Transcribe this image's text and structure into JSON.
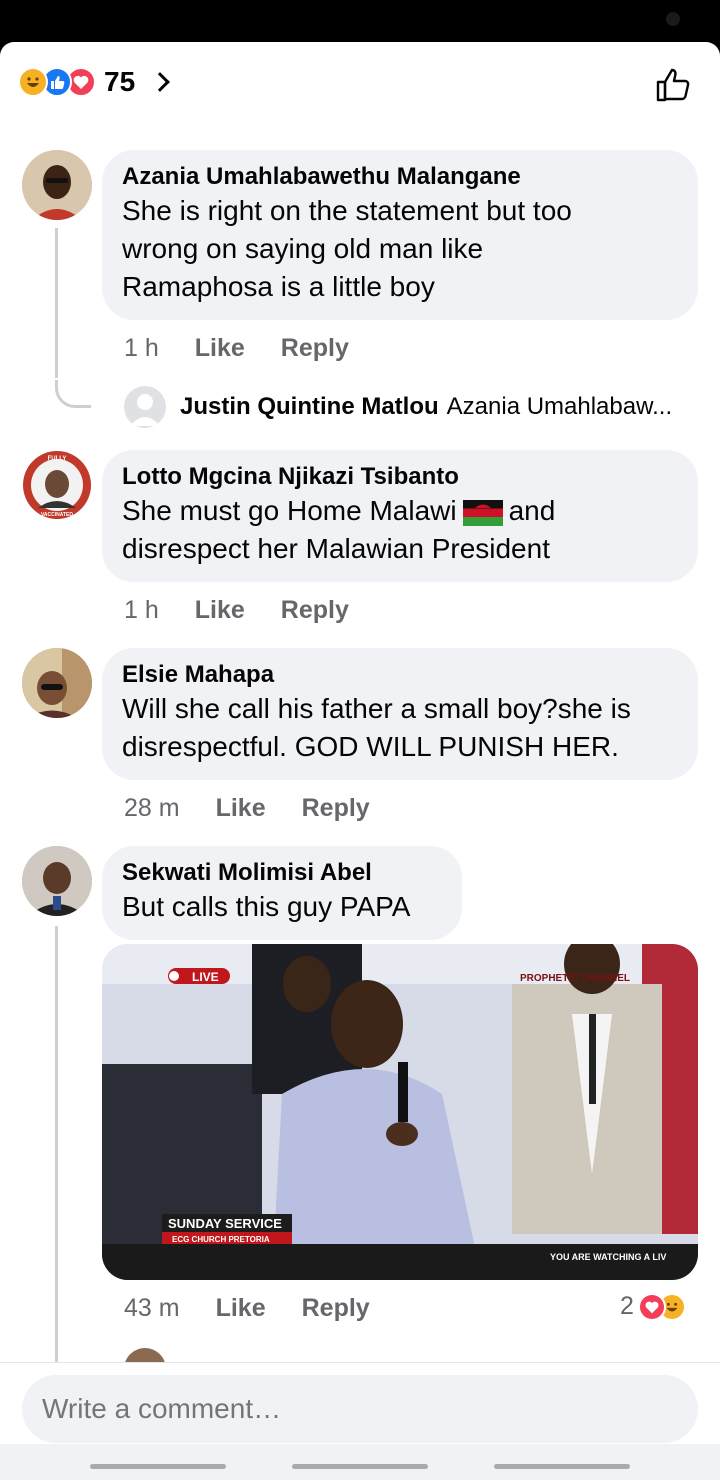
{
  "header": {
    "reaction_count": "75",
    "reaction_icons": [
      "haha-icon",
      "like-icon",
      "love-icon"
    ]
  },
  "comments": [
    {
      "author": "Azania Umahlabawethu Malangane",
      "text_lines": [
        "She is right on the statement but too",
        "wrong on saying old man like",
        "Ramaphosa is a little boy"
      ],
      "time": "1 h",
      "like": "Like",
      "reply": "Reply"
    },
    {
      "author": "Lotto Mgcina Njikazi Tsibanto",
      "text_line1_a": "She must go Home Malawi",
      "text_line1_b": "and",
      "text_line2": "disrespect her Malawian President",
      "time": "1 h",
      "like": "Like",
      "reply": "Reply"
    },
    {
      "author": "Elsie Mahapa",
      "text_lines": [
        "Will she call his father a small boy?she is",
        "disrespectful. GOD WILL PUNISH HER."
      ],
      "time": "28 m",
      "like": "Like",
      "reply": "Reply"
    },
    {
      "author": "Sekwati Molimisi Abel",
      "text_lines": [
        "But calls this guy PAPA"
      ],
      "time": "43 m",
      "like": "Like",
      "reply": "Reply",
      "reaction_count": "2"
    }
  ],
  "reply_preview": {
    "author": "Justin Quintine Matlou",
    "preview": "Azania Umahlabaw..."
  },
  "media": {
    "live_badge": "LIVE",
    "channel": "PROPHETIC CHANNEL",
    "lower_third_title": "SUNDAY SERVICE",
    "lower_third_sub": "ECG CHURCH PRETORIA",
    "ticker": "YOU ARE WATCHING A LIV"
  },
  "avatar_badge_top": "FULLY",
  "avatar_badge_bottom": "VACCINATED",
  "composer": {
    "placeholder": "Write a comment…"
  },
  "colors": {
    "bubble": "#f0f2f5",
    "meta": "#65676b",
    "like_blue": "#1877f2",
    "love_red": "#f33e58",
    "haha_yellow": "#f7b125"
  }
}
